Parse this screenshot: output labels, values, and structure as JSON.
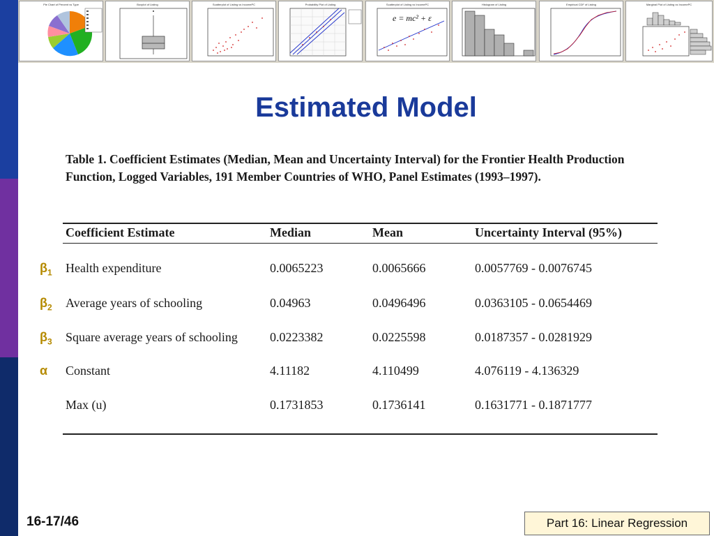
{
  "theme": {
    "sidebar_colors": [
      "#1b3fa0",
      "#7030a0",
      "#0f2b6a"
    ],
    "title_color": "#1a3a9a",
    "symbol_color": "#b58a00",
    "footer_bg": "#fff6d8"
  },
  "thumbnails": [
    {
      "title": "Pie Chart of Percent vs Type"
    },
    {
      "title": "Boxplot of Listing"
    },
    {
      "title": "Scatterplot of Listing vs IncomePC"
    },
    {
      "title": "Probability Plot of Listing"
    },
    {
      "title": "Scatterplot of Listing vs IncomePC",
      "formula": "e = mc² + ε"
    },
    {
      "title": "Histogram of Listing"
    },
    {
      "title": "Empirical CDF of Listing"
    },
    {
      "title": "Marginal Plot of Listing vs IncomePC"
    }
  ],
  "title": "Estimated Model",
  "table": {
    "caption": "Table 1. Coefficient Estimates (Median, Mean and Uncertainty Interval) for the Frontier Health Production Function, Logged Variables, 191 Member Countries of WHO, Panel Estimates (1993–1997).",
    "headers": [
      "Coefficient Estimate",
      "Median",
      "Mean",
      "Uncertainty Interval (95%)"
    ],
    "rows": [
      {
        "symbol": "β",
        "sub": "1",
        "name": "Health expenditure",
        "median": "0.0065223",
        "mean": "0.0065666",
        "interval": "0.0057769 - 0.0076745"
      },
      {
        "symbol": "β",
        "sub": "2",
        "name": "Average years of schooling",
        "median": "0.04963",
        "mean": "0.0496496",
        "interval": "0.0363105 - 0.0654469"
      },
      {
        "symbol": "β",
        "sub": "3",
        "name": "Square average years of schooling",
        "median": "0.0223382",
        "mean": "0.0225598",
        "interval": "0.0187357 - 0.0281929"
      },
      {
        "symbol": "α",
        "sub": "",
        "name": "Constant",
        "median": "4.11182",
        "mean": "4.110499",
        "interval": "4.076119 - 4.136329"
      },
      {
        "symbol": "",
        "sub": "",
        "name": "Max (u)",
        "median": "0.1731853",
        "mean": "0.1736141",
        "interval": "0.1631771 - 0.1871777"
      }
    ]
  },
  "footer": {
    "slide_number": "16-17/46",
    "part_label": "Part 16: Linear Regression"
  }
}
